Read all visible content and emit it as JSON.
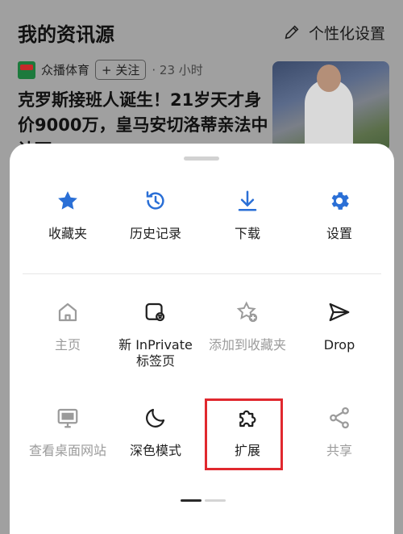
{
  "feed": {
    "title": "我的资讯源",
    "personalize_label": "个性化设置",
    "news": {
      "source": "众播体育",
      "follow_label": "+ 关注",
      "time": "· 23 小时",
      "headline": "克罗斯接班人诞生！21岁天才身价9000万，皇马安切洛蒂亲法中认可"
    }
  },
  "menu": {
    "row1": [
      {
        "label": "收藏夹",
        "icon": "star-icon"
      },
      {
        "label": "历史记录",
        "icon": "history-icon"
      },
      {
        "label": "下载",
        "icon": "download-icon"
      },
      {
        "label": "设置",
        "icon": "gear-icon"
      }
    ],
    "row2": [
      {
        "label": "主页",
        "icon": "home-icon"
      },
      {
        "label": "新 InPrivate\n标签页",
        "icon": "inprivate-icon"
      },
      {
        "label": "添加到收藏夹",
        "icon": "add-favorite-icon"
      },
      {
        "label": "Drop",
        "icon": "send-icon"
      }
    ],
    "row3": [
      {
        "label": "查看桌面网站",
        "icon": "desktop-icon"
      },
      {
        "label": "深色模式",
        "icon": "moon-icon"
      },
      {
        "label": "扩展",
        "icon": "puzzle-icon"
      },
      {
        "label": "共享",
        "icon": "share-icon"
      }
    ]
  },
  "colors": {
    "accent": "#2a6fd6",
    "highlight_box": "#e0282e",
    "disabled": "#9b9b9b"
  },
  "pager": {
    "current_page": 1,
    "total_pages": 2
  }
}
